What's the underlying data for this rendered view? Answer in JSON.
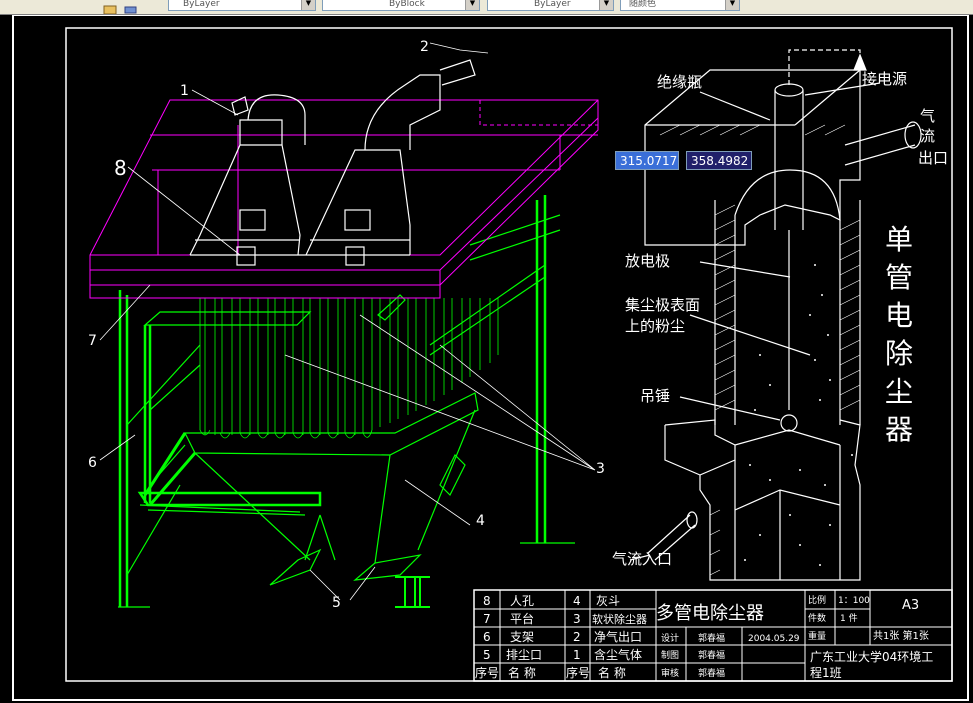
{
  "toolbar": {
    "linetype_value": "ByLayer",
    "lineweight_value": "ByBlock",
    "plotstyle_value": "ByLayer",
    "color_value": "随颜色"
  },
  "drawing": {
    "left_callouts": [
      "1",
      "2",
      "8",
      "7",
      "6",
      "3",
      "4",
      "5"
    ],
    "right_labels": {
      "insulator": "绝缘瓶",
      "power": "接电源",
      "gas_out": [
        "气",
        "流",
        "出口"
      ],
      "electrode": "放电极",
      "dust_line1": "集尘极表面",
      "dust_line2": "上的粉尘",
      "weight": "吊锤",
      "gas_in": "气流入口"
    },
    "vertical_title": [
      "单",
      "管",
      "电",
      "除",
      "尘",
      "器"
    ]
  },
  "dynamic_input": {
    "x": "315.0717",
    "y": "358.4982"
  },
  "title_block": {
    "parts": [
      {
        "no_a": "8",
        "name_a": "人孔",
        "no_b": "4",
        "name_b": "灰斗"
      },
      {
        "no_a": "7",
        "name_a": "平台",
        "no_b": "3",
        "name_b": "软状除尘器"
      },
      {
        "no_a": "6",
        "name_a": "支架",
        "no_b": "2",
        "name_b": "净气出口"
      },
      {
        "no_a": "5",
        "name_a": "排尘口",
        "no_b": "1",
        "name_b": "含尘气体"
      }
    ],
    "header": {
      "no_a": "序号",
      "name_a": "名 称",
      "no_b": "序号",
      "name_b": "名 称"
    },
    "drawing_title": "多管电除尘器",
    "scale_label": "比例",
    "scale_value": "1：100",
    "count_label": "件数",
    "count_value": "1 件",
    "weight_label": "重量",
    "sheet_info": "共1张  第1张",
    "paper_size": "A3",
    "design_label": "设计",
    "design_name": "郭春福",
    "design_date": "2004.05.29",
    "draw_label": "制图",
    "draw_name": "郭春福",
    "check_label": "审核",
    "check_name": "郭春福",
    "school_line1": "广东工业大学04环境工",
    "school_line2": "程1班"
  },
  "colors": {
    "green": "#00ff00",
    "magenta": "#ff00ff",
    "white": "#ffffff",
    "background": "#000000"
  }
}
